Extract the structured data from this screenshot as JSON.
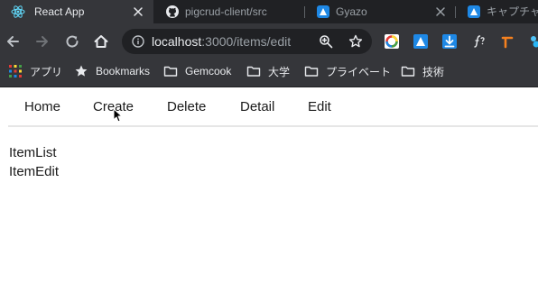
{
  "browser": {
    "tabs": [
      {
        "title": "React App",
        "favicon": "react-icon",
        "active": true
      },
      {
        "title": "pigcrud-client/src",
        "favicon": "github-icon",
        "active": false
      },
      {
        "title": "Gyazo",
        "favicon": "gyazo-icon",
        "active": false
      },
      {
        "title": "キャプチャ",
        "favicon": "gyazo-icon",
        "active": false
      }
    ],
    "address": {
      "host": "localhost",
      "path": ":3000/items/edit"
    },
    "icons": [
      "back-icon",
      "forward-icon",
      "reload-icon",
      "home-icon",
      "lock-icon",
      "zoom-icon",
      "bookmark-star-icon"
    ],
    "extensions": [
      "color-picker-ext-icon",
      "gyazo-ext-icon",
      "download-ext-icon",
      "formula-ext-icon",
      "orange-ext-icon",
      "blue-ext-icon"
    ],
    "bookmarks": [
      {
        "label": "アプリ",
        "icon": "apps-grid-icon"
      },
      {
        "label": "Bookmarks",
        "icon": "star-icon"
      },
      {
        "label": "Gemcook",
        "icon": "folder-icon"
      },
      {
        "label": "大学",
        "icon": "folder-icon"
      },
      {
        "label": "プライベート",
        "icon": "folder-icon"
      },
      {
        "label": "技術",
        "icon": "folder-icon"
      }
    ]
  },
  "app": {
    "nav": {
      "home": "Home",
      "create": "Create",
      "delete": "Delete",
      "detail": "Detail",
      "edit": "Edit"
    },
    "content": {
      "line1": "ItemList",
      "line2": "ItemEdit"
    }
  },
  "colors": {
    "tabstrip_bg": "#202124",
    "toolbar_bg": "#35363a",
    "page_bg": "#ffffff",
    "nav_underline": "#e6e6e6"
  }
}
